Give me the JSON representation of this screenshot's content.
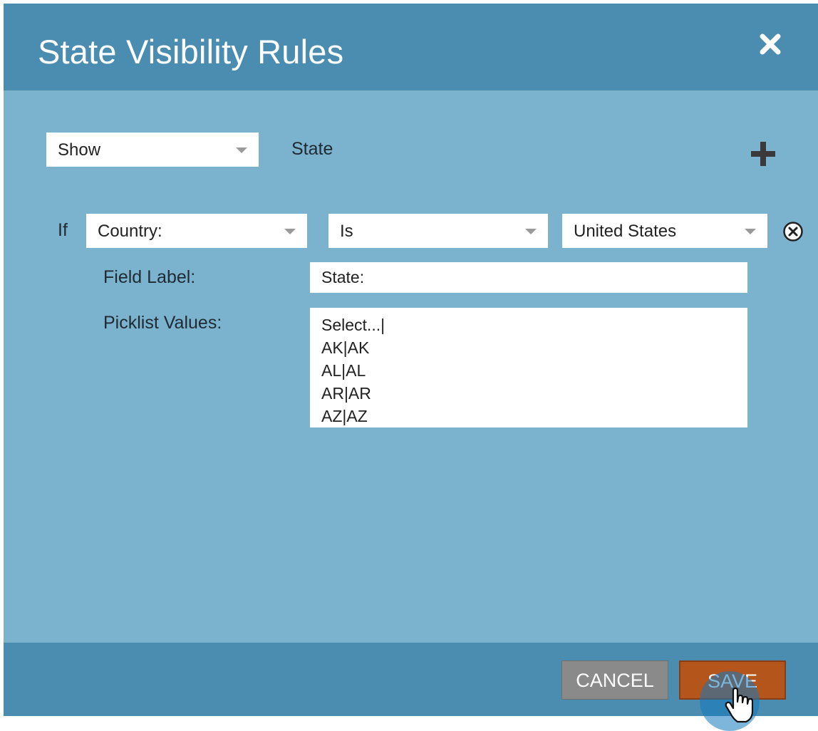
{
  "dialog": {
    "title": "State Visibility Rules"
  },
  "rule": {
    "action_value": "Show",
    "target_field": "State"
  },
  "condition": {
    "if_label": "If",
    "field_value": "Country:",
    "operator_value": "Is",
    "match_value": "United States"
  },
  "field_label": {
    "label": "Field Label:",
    "value": "State:"
  },
  "picklist": {
    "label": "Picklist Values:",
    "values": [
      "Select...|",
      "AK|AK",
      "AL|AL",
      "AR|AR",
      "AZ|AZ"
    ]
  },
  "footer": {
    "cancel_label": "CANCEL",
    "save_label": "SAVE"
  },
  "colors": {
    "header": "#4a8db0",
    "body": "#7bb3cf",
    "save": "#b4561c",
    "cancel": "#8a8a8a"
  },
  "icons": {
    "close": "close-icon",
    "add": "plus-icon",
    "remove": "remove-circle-icon",
    "dropdown": "chevron-down-icon"
  }
}
